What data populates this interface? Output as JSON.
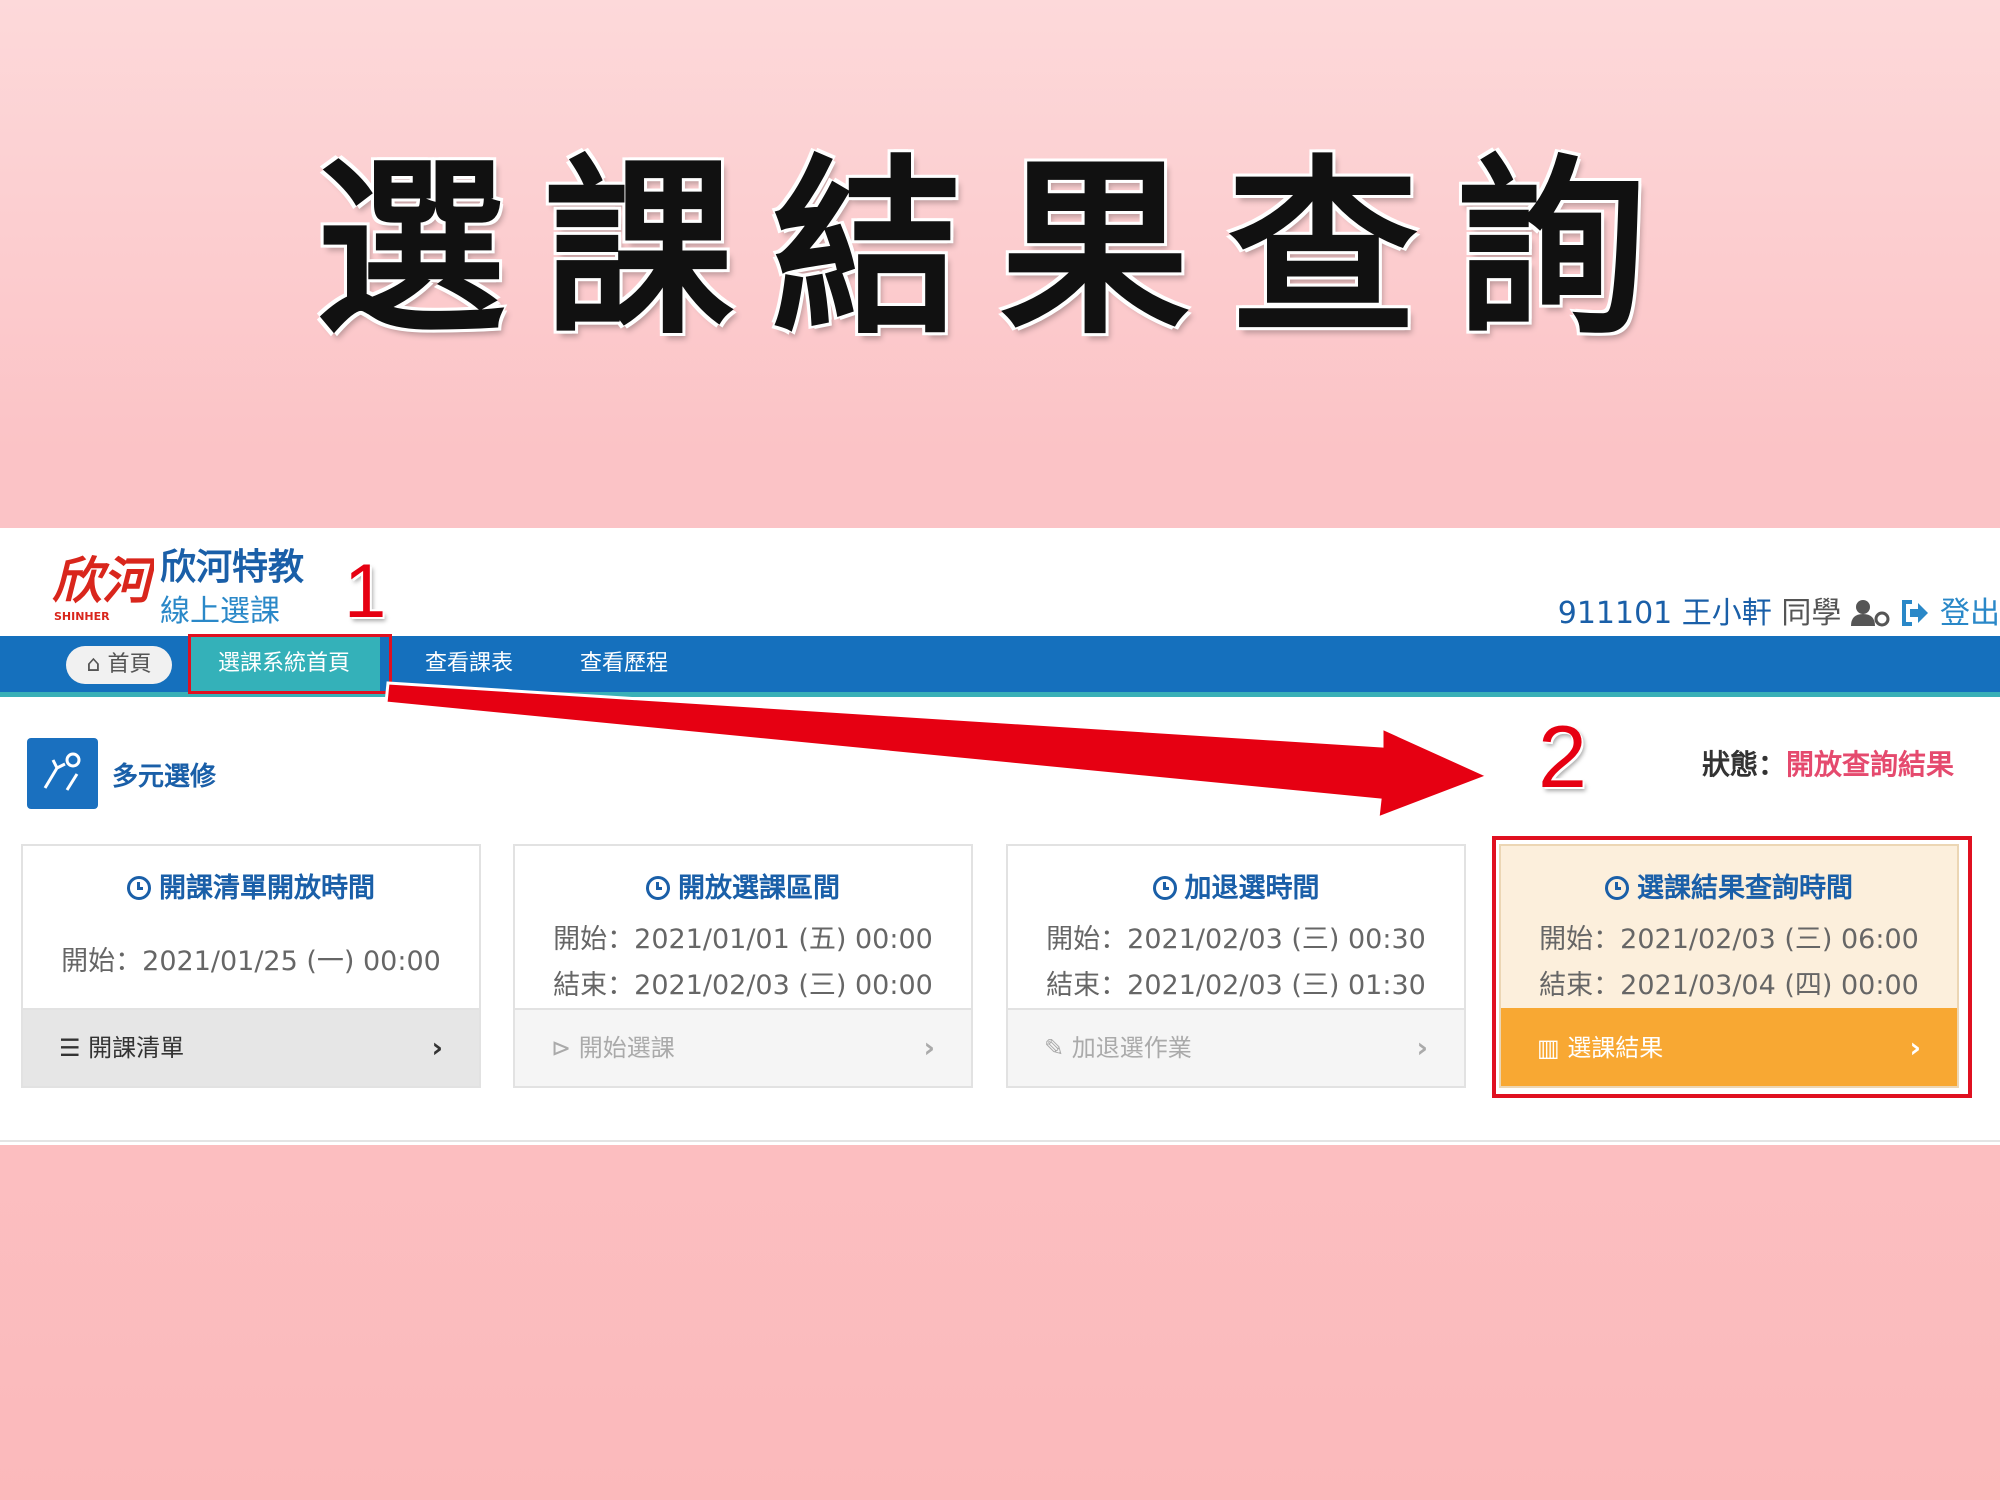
{
  "slide": {
    "title": "選課結果查詢"
  },
  "header": {
    "brand_name": "欣河特教",
    "brand_sub": "線上選課",
    "logo_text": "欣河",
    "logo_en": "SHINHER",
    "student": "911101 王小軒",
    "student_suffix": "同學",
    "logout": "登出"
  },
  "nav": {
    "home": "首頁",
    "tabs": [
      "選課系統首頁",
      "查看課表",
      "查看歷程"
    ]
  },
  "callouts": {
    "one": "1",
    "two": "2"
  },
  "section": {
    "title": "多元選修",
    "status_label": "狀態：",
    "status_value": "開放查詢結果"
  },
  "cards": [
    {
      "title": "開課清單開放時間",
      "start": "開始：2021/01/25 (一) 00:00",
      "action": "開課清單",
      "icon": "list-icon"
    },
    {
      "title": "開放選課區間",
      "start": "開始：2021/01/01 (五) 00:00",
      "end": "結束：2021/02/03 (三) 00:00",
      "action": "開始選課",
      "icon": "play-icon"
    },
    {
      "title": "加退選時間",
      "start": "開始：2021/02/03 (三) 00:30",
      "end": "結束：2021/02/03 (三) 01:30",
      "action": "加退選作業",
      "icon": "edit-icon"
    },
    {
      "title": "選課結果查詢時間",
      "start": "開始：2021/02/03 (三) 06:00",
      "end": "結束：2021/03/04 (四) 00:00",
      "action": "選課結果",
      "icon": "bar-chart-icon"
    }
  ],
  "colors": {
    "nav_bg": "#1570bd",
    "active_tab": "#34b1b9",
    "highlight_footer": "#f8a833",
    "annotation_red": "#e01020"
  }
}
